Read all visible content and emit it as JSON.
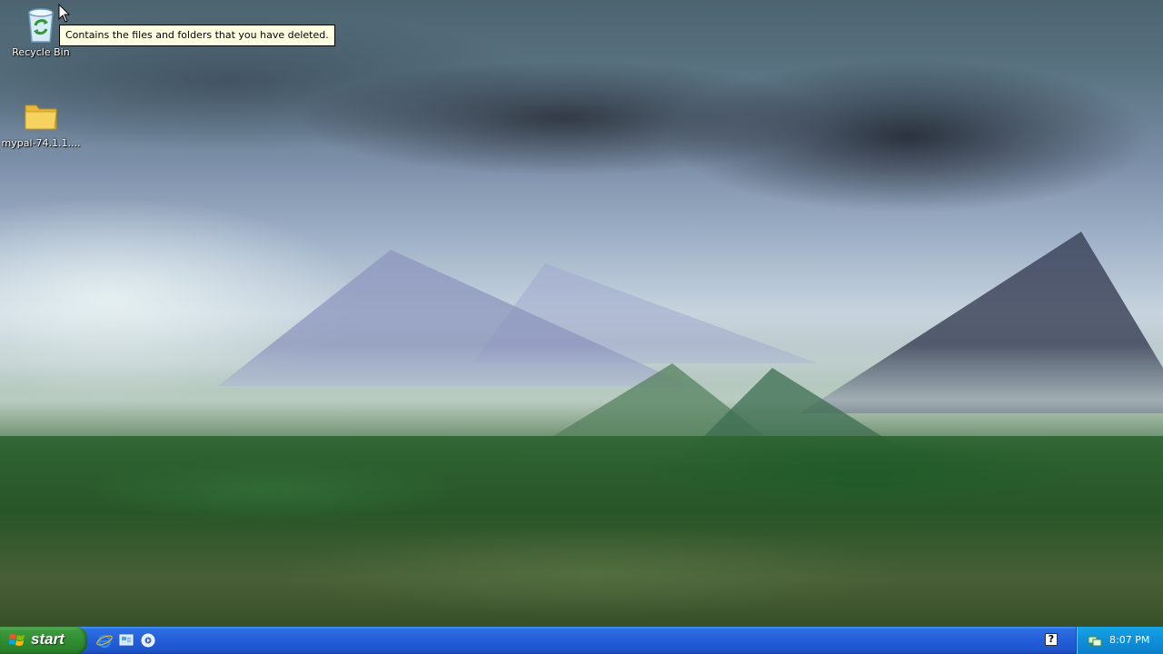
{
  "desktop": {
    "icons": [
      {
        "label": "Recycle Bin",
        "icon": "recycle-bin-icon"
      },
      {
        "label": "mypal-74.1.1....",
        "icon": "folder-icon"
      }
    ],
    "tooltip": "Contains the files and folders that you have deleted."
  },
  "taskbar": {
    "start_label": "start",
    "quick_launch": [
      {
        "icon": "internet-explorer-icon"
      },
      {
        "icon": "show-desktop-icon"
      },
      {
        "icon": "media-player-icon"
      }
    ],
    "tray": {
      "help_glyph": "?",
      "clock": "8:07 PM",
      "tray_icon": "network-icon"
    }
  },
  "colors": {
    "taskbar": "#245edb",
    "start_button": "#3c9a3c",
    "tray": "#0f8fd9",
    "tooltip_bg": "#ffffe1"
  }
}
